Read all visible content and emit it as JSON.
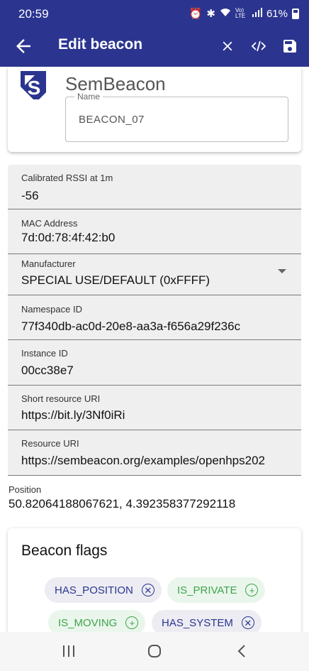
{
  "status": {
    "time": "20:59",
    "network": "Vo) LTE",
    "battery": "61%"
  },
  "appbar": {
    "title": "Edit beacon"
  },
  "header": {
    "brand": "SemBeacon",
    "name_label": "Name",
    "name_value": "BEACON_07"
  },
  "fields": [
    {
      "label": "Calibrated RSSI at 1m",
      "value": "-56"
    },
    {
      "label": "MAC Address",
      "value": "7d:0d:78:4f:42:b0"
    },
    {
      "label": "Manufacturer",
      "value": "SPECIAL USE/DEFAULT (0xFFFF)"
    },
    {
      "label": "Namespace ID",
      "value": "77f340db-ac0d-20e8-aa3a-f656a29f236c"
    },
    {
      "label": "Instance ID",
      "value": "00cc38e7"
    },
    {
      "label": "Short resource URI",
      "value": "https://bit.ly/3Nf0iRi"
    },
    {
      "label": "Resource URI",
      "value": "https://sembeacon.org/examples/openhps202"
    }
  ],
  "position": {
    "label": "Position",
    "value": "50.82064188067621, 4.392358377292118"
  },
  "flags": {
    "title": "Beacon flags",
    "chips": [
      {
        "label": "HAS_POSITION",
        "state": "set"
      },
      {
        "label": "IS_PRIVATE",
        "state": "unset"
      },
      {
        "label": "IS_MOVING",
        "state": "unset"
      },
      {
        "label": "HAS_SYSTEM",
        "state": "set"
      }
    ]
  },
  "colors": {
    "primary": "#2b3590",
    "chip_set_text": "#2b3590",
    "chip_unset_text": "#3fa44c",
    "field_bg": "#efefef"
  }
}
